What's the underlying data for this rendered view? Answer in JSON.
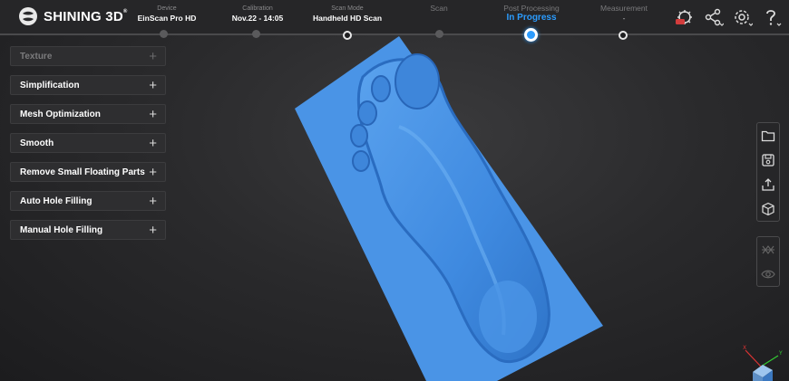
{
  "brand": {
    "name": "SHINING 3D",
    "mark": "®"
  },
  "steps": [
    {
      "label": "Device",
      "value": "EinScan Pro HD"
    },
    {
      "label": "Calibration",
      "value": "Nov.22 - 14:05"
    },
    {
      "label": "Scan Mode",
      "value": "Handheld HD Scan"
    },
    {
      "label": "Scan",
      "value": ""
    },
    {
      "label": "Post Processing",
      "value": "In Progress"
    },
    {
      "label": "Measurement",
      "value": "-"
    }
  ],
  "top_icons": [
    "remote-service-icon",
    "share-icon",
    "settings-icon",
    "help-icon"
  ],
  "panel": {
    "items": [
      {
        "label": "Texture",
        "enabled": false
      },
      {
        "label": "Simplification",
        "enabled": true
      },
      {
        "label": "Mesh Optimization",
        "enabled": true
      },
      {
        "label": "Smooth",
        "enabled": true
      },
      {
        "label": "Remove Small Floating Parts",
        "enabled": true
      },
      {
        "label": "Auto Hole Filling",
        "enabled": true
      },
      {
        "label": "Manual Hole Filling",
        "enabled": true
      }
    ],
    "plus": "+"
  },
  "right_toolbar": {
    "group1": [
      "open-folder-icon",
      "save-icon",
      "export-icon",
      "view-cube-icon"
    ],
    "group2": [
      "mesh-toggle-icon",
      "visibility-icon"
    ]
  },
  "colors": {
    "accent": "#2b9cff",
    "model": "#4a94e6",
    "badge": "#d33c3c"
  },
  "axis_labels": {
    "x": "X",
    "y": "Y",
    "z": "Z"
  }
}
